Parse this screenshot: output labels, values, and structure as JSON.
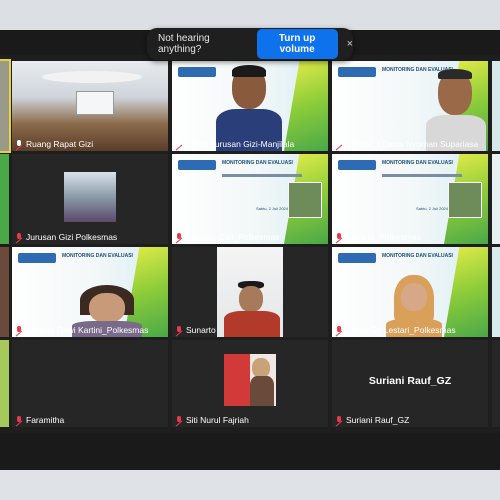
{
  "notice": {
    "message": "Not hearing anything?",
    "button_label": "Turn up volume",
    "close_glyph": "×"
  },
  "slide": {
    "title": "MONITORING DAN EVALUASI",
    "date": "Sabtu, 2 Juli 2024"
  },
  "participants": [
    {
      "name": "Ruang Rapat Gizi",
      "mic": "pin"
    },
    {
      "name": "Ketua Jurusan Gizi-Manjilala",
      "mic": "pin"
    },
    {
      "name": "Asesor_I Dewa Nyoman Supariasa",
      "mic": "pin"
    },
    {
      "name": "Jurusan Gizi Polkesmas",
      "mic": "muted"
    },
    {
      "name": "Jurusan Gizi_Polkesmas",
      "mic": "muted"
    },
    {
      "name": "Zakaria_Polkesmas",
      "mic": "muted"
    },
    {
      "name": "Thresia Dewi Kartini_Polkesmas",
      "mic": "muted"
    },
    {
      "name": "Sunarto",
      "mic": "muted"
    },
    {
      "name": "Retno Sri Lestari_Polkesmas",
      "mic": "muted"
    },
    {
      "name": "Faramitha",
      "mic": "muted"
    },
    {
      "name": "Siti Nurul Fajriah",
      "mic": "muted"
    },
    {
      "name": "Suriani Rauf_GZ",
      "mic": "muted"
    }
  ],
  "name_card": "Suriani Rauf_GZ"
}
